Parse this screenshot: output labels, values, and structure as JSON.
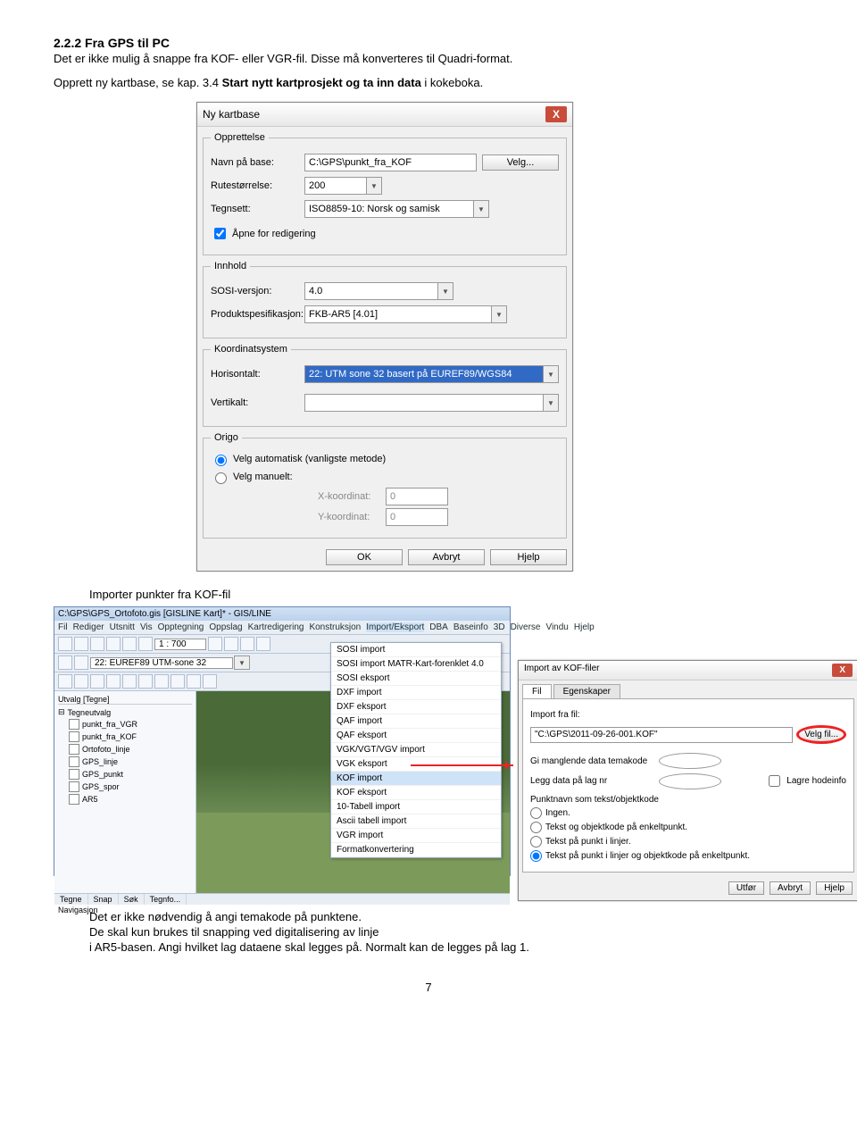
{
  "heading": "2.2.2 Fra GPS til PC",
  "para1": "Det er ikke mulig å snappe fra KOF- eller VGR-fil. Disse må konverteres til Quadri-format.",
  "para2a": "Opprett ny kartbase, se kap. 3.4 ",
  "para2b": "Start nytt kartprosjekt og ta inn data",
  "para2c": " i kokeboka.",
  "dlg1": {
    "title": "Ny kartbase",
    "grp_opprettelse": "Opprettelse",
    "lbl_navn": "Navn på base:",
    "val_navn": "C:\\GPS\\punkt_fra_KOF",
    "btn_velg": "Velg...",
    "lbl_rute": "Rutestørrelse:",
    "val_rute": "200",
    "lbl_tegn": "Tegnsett:",
    "val_tegn": "ISO8859-10: Norsk og samisk",
    "chk_apne": "Åpne for redigering",
    "grp_innhold": "Innhold",
    "lbl_sosi": "SOSI-versjon:",
    "val_sosi": "4.0",
    "lbl_prod": "Produktspesifikasjon:",
    "val_prod": "FKB-AR5 [4.01]",
    "grp_koord": "Koordinatsystem",
    "lbl_horis": "Horisontalt:",
    "val_horis": "22: UTM sone 32 basert på EUREF89/WGS84",
    "lbl_vert": "Vertikalt:",
    "val_vert": "",
    "grp_origo": "Origo",
    "radio_auto": "Velg automatisk (vanligste metode)",
    "radio_man": "Velg manuelt:",
    "lbl_x": "X-koordinat:",
    "val_x": "0",
    "lbl_y": "Y-koordinat:",
    "val_y": "0",
    "btn_ok": "OK",
    "btn_avbryt": "Avbryt",
    "btn_hjelp": "Hjelp"
  },
  "caption2": "Importer punkter fra KOF-fil",
  "app": {
    "title": "C:\\GPS\\GPS_Ortofoto.gis [GISLINE Kart]* - GIS/LINE",
    "menu": [
      "Fil",
      "Rediger",
      "Utsnitt",
      "Vis",
      "Opptegning",
      "Oppslag",
      "Kartredigering",
      "Konstruksjon",
      "Import/Eksport",
      "DBA",
      "Baseinfo",
      "3D",
      "Diverse",
      "Vindu",
      "Hjelp"
    ],
    "scale": "1 : 700",
    "coord": "22: EUREF89 UTM-sone 32",
    "panel_label": "Utvalg [Tegne]",
    "tree_root": "Tegneutvalg",
    "tree": [
      "punkt_fra_VGR",
      "punkt_fra_KOF",
      "Ortofoto_linje",
      "GPS_linje",
      "GPS_punkt",
      "GPS_spor",
      "AR5"
    ],
    "status": [
      "Tegne",
      "Snap",
      "Søk",
      "Tegnfo..."
    ],
    "nav": "Navigasjon",
    "dropdown": [
      "SOSI import",
      "SOSI import MATR-Kart-forenklet 4.0",
      "SOSI eksport",
      "DXF import",
      "DXF eksport",
      "QAF import",
      "QAF eksport",
      "VGK/VGT/VGV import",
      "VGK eksport",
      "KOF import",
      "KOF eksport",
      "10-Tabell import",
      "Ascii tabell import",
      "VGR import",
      "Formatkonvertering"
    ]
  },
  "kof": {
    "title": "Import av KOF-filer",
    "tab1": "Fil",
    "tab2": "Egenskaper",
    "lbl_import": "Import fra fil:",
    "val_import": "\"C:\\GPS\\2011-09-26-001.KOF\"",
    "btn_velg": "Velg fil...",
    "lbl_tema": "Gi manglende data temakode",
    "lbl_lag": "Legg data på lag nr",
    "chk_lagre": "Lagre hodeinfo",
    "lbl_punkt": "Punktnavn som tekst/objektkode",
    "r1": "Ingen.",
    "r2": "Tekst og objektkode på enkeltpunkt.",
    "r3": "Tekst på punkt i linjer.",
    "r4": "Tekst på punkt i linjer og objektkode på enkeltpunkt.",
    "btn_utfor": "Utfør",
    "btn_avbryt": "Avbryt",
    "btn_hjelp": "Hjelp"
  },
  "para3a": "Det er ikke nødvendig å angi temakode på punktene.",
  "para3b": "De skal kun brukes til snapping ved digitalisering av linje",
  "para3c": "i AR5-basen. Angi hvilket lag dataene skal legges på. Normalt kan de legges på lag 1.",
  "page": "7"
}
